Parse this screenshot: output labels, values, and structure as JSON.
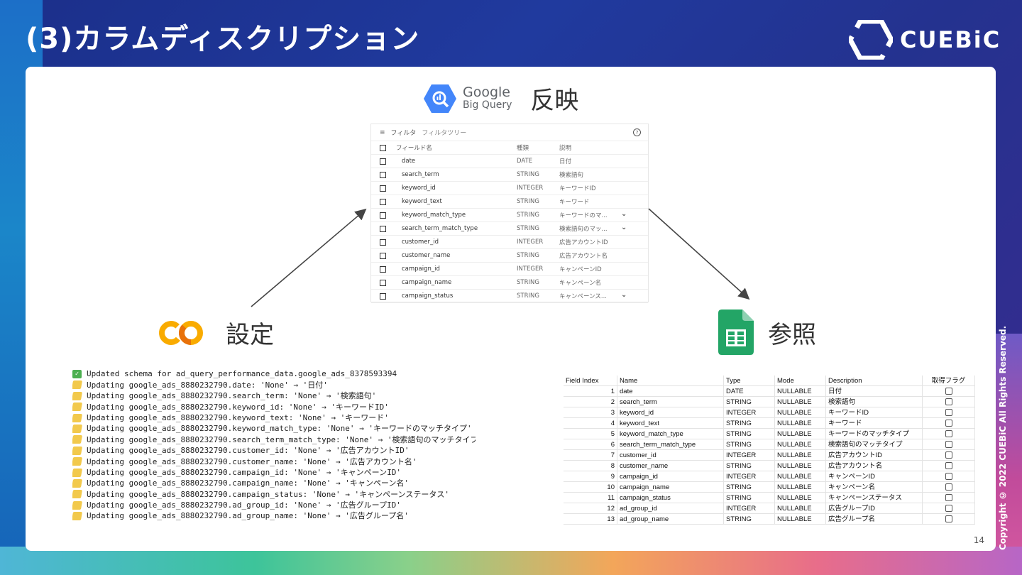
{
  "slide": {
    "title": "(3)カラムディスクリプション",
    "logo_text": "CUEBiC",
    "copyright": "Copyright © 2022 CUEBiC All Rights Reserved.",
    "page_number": "14"
  },
  "bigquery": {
    "brand_google": "Google",
    "brand_product": "Big Query",
    "label": "反映",
    "filter_label": "フィルタ",
    "filter_placeholder": "フィルタツリー",
    "help_icon": "?",
    "headers": [
      "フィールド名",
      "種類",
      "説明"
    ],
    "rows": [
      {
        "name": "date",
        "type": "DATE",
        "desc": "日付",
        "chevron": false
      },
      {
        "name": "search_term",
        "type": "STRING",
        "desc": "検索語句",
        "chevron": false
      },
      {
        "name": "keyword_id",
        "type": "INTEGER",
        "desc": "キーワードID",
        "chevron": false
      },
      {
        "name": "keyword_text",
        "type": "STRING",
        "desc": "キーワード",
        "chevron": false
      },
      {
        "name": "keyword_match_type",
        "type": "STRING",
        "desc": "キーワードのマ...",
        "chevron": true
      },
      {
        "name": "search_term_match_type",
        "type": "STRING",
        "desc": "検索語句のマッ...",
        "chevron": true
      },
      {
        "name": "customer_id",
        "type": "INTEGER",
        "desc": "広告アカウントID",
        "chevron": false
      },
      {
        "name": "customer_name",
        "type": "STRING",
        "desc": "広告アカウント名",
        "chevron": false
      },
      {
        "name": "campaign_id",
        "type": "INTEGER",
        "desc": "キャンペーンID",
        "chevron": false
      },
      {
        "name": "campaign_name",
        "type": "STRING",
        "desc": "キャンペーン名",
        "chevron": false
      },
      {
        "name": "campaign_status",
        "type": "STRING",
        "desc": "キャンペーンス...",
        "chevron": true
      }
    ]
  },
  "colab": {
    "label": "設定",
    "logo_text": "CO",
    "console": [
      {
        "icon": "check",
        "text": "Updated schema for ad_query_performance_data.google_ads_8378593394"
      },
      {
        "icon": "pencil",
        "text": "Updating google_ads_8880232790.date: 'None' → '日付'"
      },
      {
        "icon": "pencil",
        "text": "Updating google_ads_8880232790.search_term: 'None' → '検索語句'"
      },
      {
        "icon": "pencil",
        "text": "Updating google_ads_8880232790.keyword_id: 'None' → 'キーワードID'"
      },
      {
        "icon": "pencil",
        "text": "Updating google_ads_8880232790.keyword_text: 'None' → 'キーワード'"
      },
      {
        "icon": "pencil",
        "text": "Updating google_ads_8880232790.keyword_match_type: 'None' → 'キーワードのマッチタイプ'"
      },
      {
        "icon": "pencil",
        "text": "Updating google_ads_8880232790.search_term_match_type: 'None' → '検索語句のマッチタイプ'"
      },
      {
        "icon": "pencil",
        "text": "Updating google_ads_8880232790.customer_id: 'None' → '広告アカウントID'"
      },
      {
        "icon": "pencil",
        "text": "Updating google_ads_8880232790.customer_name: 'None' → '広告アカウント名'"
      },
      {
        "icon": "pencil",
        "text": "Updating google_ads_8880232790.campaign_id: 'None' → 'キャンペーンID'"
      },
      {
        "icon": "pencil",
        "text": "Updating google_ads_8880232790.campaign_name: 'None' → 'キャンペーン名'"
      },
      {
        "icon": "pencil",
        "text": "Updating google_ads_8880232790.campaign_status: 'None' → 'キャンペーンステータス'"
      },
      {
        "icon": "pencil",
        "text": "Updating google_ads_8880232790.ad_group_id: 'None' → '広告グループID'"
      },
      {
        "icon": "pencil",
        "text": "Updating google_ads_8880232790.ad_group_name: 'None' → '広告グループ名'"
      }
    ]
  },
  "sheets": {
    "label": "参照",
    "headers": [
      "Field Index",
      "Name",
      "Type",
      "Mode",
      "Description",
      "取得フラグ"
    ],
    "rows": [
      {
        "idx": "1",
        "name": "date",
        "type": "DATE",
        "mode": "NULLABLE",
        "desc": "日付"
      },
      {
        "idx": "2",
        "name": "search_term",
        "type": "STRING",
        "mode": "NULLABLE",
        "desc": "検索語句"
      },
      {
        "idx": "3",
        "name": "keyword_id",
        "type": "INTEGER",
        "mode": "NULLABLE",
        "desc": "キーワードID"
      },
      {
        "idx": "4",
        "name": "keyword_text",
        "type": "STRING",
        "mode": "NULLABLE",
        "desc": "キーワード"
      },
      {
        "idx": "5",
        "name": "keyword_match_type",
        "type": "STRING",
        "mode": "NULLABLE",
        "desc": "キーワードのマッチタイプ"
      },
      {
        "idx": "6",
        "name": "search_term_match_type",
        "type": "STRING",
        "mode": "NULLABLE",
        "desc": "検索語句のマッチタイプ"
      },
      {
        "idx": "7",
        "name": "customer_id",
        "type": "INTEGER",
        "mode": "NULLABLE",
        "desc": "広告アカウントID"
      },
      {
        "idx": "8",
        "name": "customer_name",
        "type": "STRING",
        "mode": "NULLABLE",
        "desc": "広告アカウント名"
      },
      {
        "idx": "9",
        "name": "campaign_id",
        "type": "INTEGER",
        "mode": "NULLABLE",
        "desc": "キャンペーンID"
      },
      {
        "idx": "10",
        "name": "campaign_name",
        "type": "STRING",
        "mode": "NULLABLE",
        "desc": "キャンペーン名"
      },
      {
        "idx": "11",
        "name": "campaign_status",
        "type": "STRING",
        "mode": "NULLABLE",
        "desc": "キャンペーンステータス"
      },
      {
        "idx": "12",
        "name": "ad_group_id",
        "type": "INTEGER",
        "mode": "NULLABLE",
        "desc": "広告グループID"
      },
      {
        "idx": "13",
        "name": "ad_group_name",
        "type": "STRING",
        "mode": "NULLABLE",
        "desc": "広告グループ名"
      }
    ]
  },
  "colors": {
    "bq_blue": "#4386fa",
    "colab_orange": "#f9ab00",
    "sheets_green": "#23a566",
    "arrow": "#444444"
  }
}
